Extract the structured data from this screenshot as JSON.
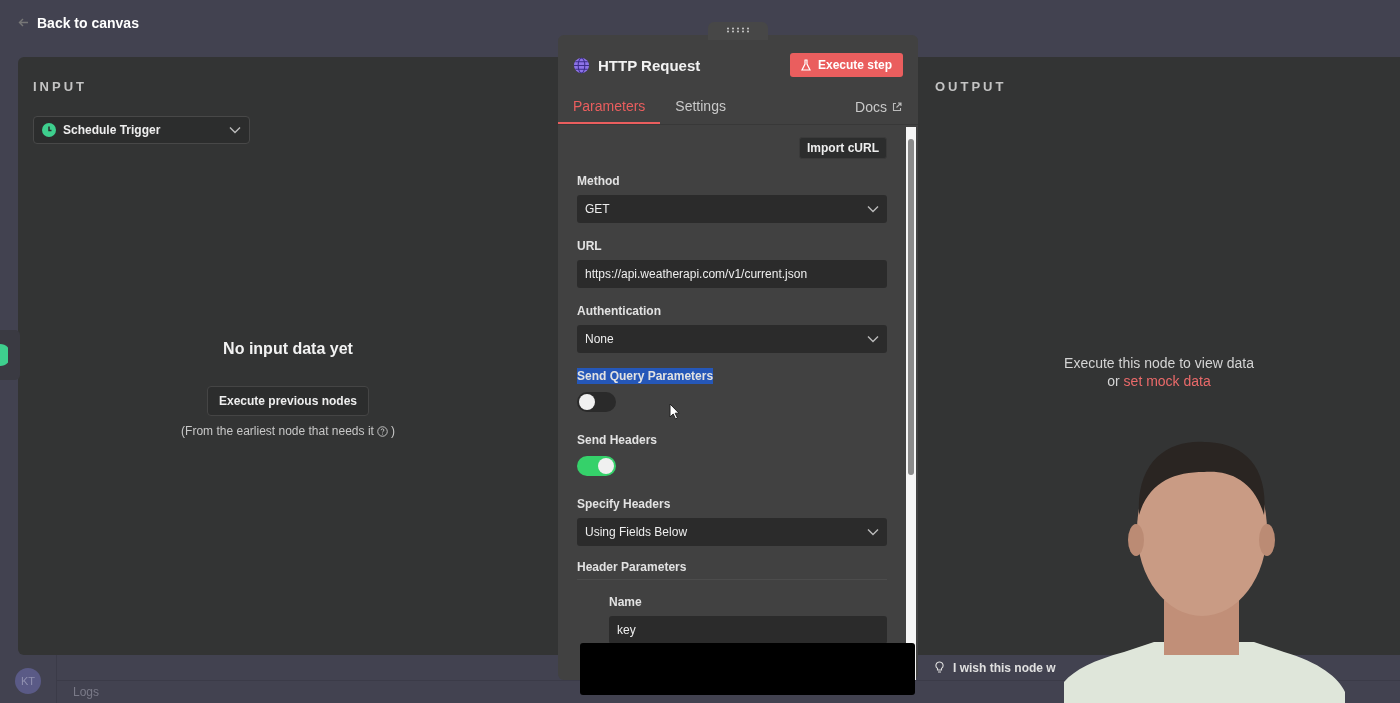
{
  "top_bar": {
    "back_link": "Back to canvas"
  },
  "input": {
    "heading": "INPUT",
    "source_select": "Schedule Trigger",
    "empty_title": "No input data yet",
    "execute_button": "Execute previous nodes",
    "hint": "(From the earliest node that needs it",
    "hint_end": ")"
  },
  "node_panel": {
    "title": "HTTP Request",
    "execute_button": "Execute step",
    "tabs": [
      {
        "label": "Parameters",
        "selected": true
      },
      {
        "label": "Settings",
        "selected": false
      }
    ],
    "docs_link": "Docs",
    "import_button": "Import cURL",
    "fields": [
      {
        "kind": "select",
        "label": "Method",
        "value": "GET"
      },
      {
        "kind": "text",
        "label": "URL",
        "value": "https://api.weatherapi.com/v1/current.json"
      },
      {
        "kind": "select",
        "label": "Authentication",
        "value": "None"
      },
      {
        "kind": "toggle",
        "label": "Send Query Parameters",
        "on": false,
        "highlighted": true
      },
      {
        "kind": "toggle",
        "label": "Send Headers",
        "on": true,
        "highlighted": false
      },
      {
        "kind": "select",
        "label": "Specify Headers",
        "value": "Using Fields Below"
      }
    ],
    "section_title": "Header Parameters",
    "header_fields": [
      {
        "label": "Name",
        "value": "key"
      }
    ]
  },
  "output": {
    "heading": "OUTPUT",
    "message": "Execute this node to view data",
    "message_suffix": "or",
    "link": "set mock data"
  },
  "bottom_bar": {
    "avatar_initials": "KT",
    "hint": "I wish this node w",
    "logs_tab": "Logs"
  }
}
